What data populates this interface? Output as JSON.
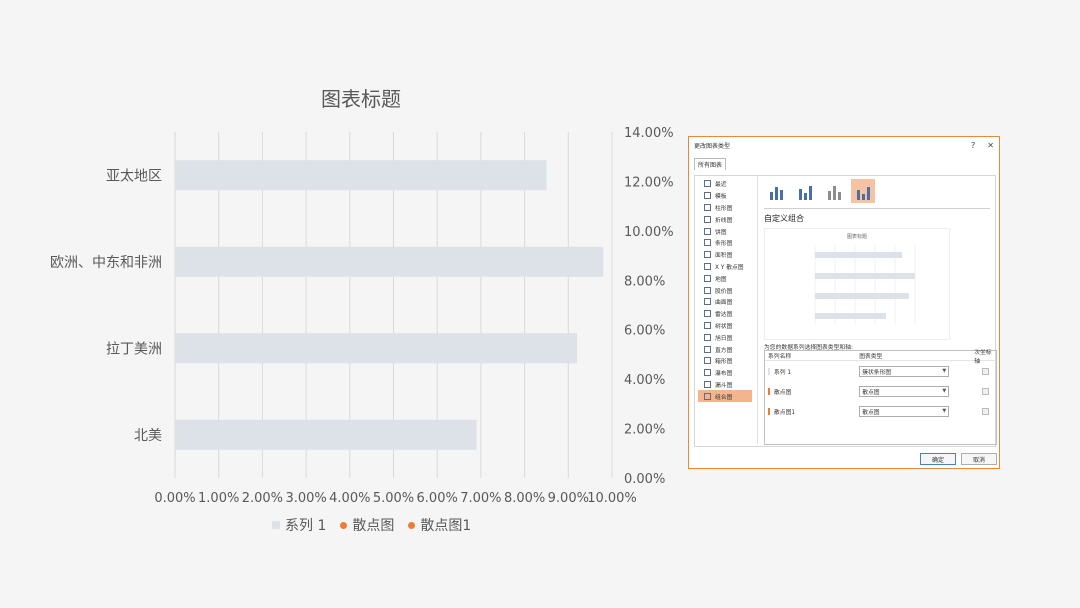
{
  "chart_data": {
    "type": "bar",
    "title": "图表标题",
    "categories": [
      "亚太地区",
      "欧洲、中东和非洲",
      "拉丁美洲",
      "北美"
    ],
    "series": [
      {
        "name": "系列 1",
        "values": [
          0.085,
          0.098,
          0.092,
          0.069
        ]
      }
    ],
    "x_ticks": [
      "0.00%",
      "1.00%",
      "2.00%",
      "3.00%",
      "4.00%",
      "5.00%",
      "6.00%",
      "7.00%",
      "8.00%",
      "9.00%",
      "10.00%"
    ],
    "xlim": [
      0,
      0.1
    ],
    "secondary_y_ticks": [
      "14.00%",
      "12.00%",
      "10.00%",
      "8.00%",
      "6.00%",
      "4.00%",
      "2.00%",
      "0.00%"
    ],
    "secondary_ylim": [
      0,
      0.14
    ],
    "grid": true,
    "legend_position": "bottom",
    "legend": [
      {
        "name": "系列 1",
        "color": "#dce2e8",
        "shape": "square"
      },
      {
        "name": "散点图",
        "color": "#ed7d31",
        "shape": "dot"
      },
      {
        "name": "散点图1",
        "color": "#ed7d31",
        "shape": "dot"
      }
    ],
    "bar_color": "#dce2e8"
  },
  "dialog": {
    "title": "更改图表类型",
    "help": "?",
    "close": "✕",
    "tab": "所有图表",
    "categories": [
      "最近",
      "模板",
      "柱形图",
      "折线图",
      "饼图",
      "条形图",
      "面积图",
      "X Y 散点图",
      "地图",
      "股价图",
      "曲面图",
      "雷达图",
      "树状图",
      "旭日图",
      "直方图",
      "箱形图",
      "瀑布图",
      "漏斗图",
      "组合图"
    ],
    "selected_category": "组合图",
    "combo_title": "自定义组合",
    "preview_title": "图表标题",
    "prompt": "为您的数据系列选择图表类型和轴:",
    "columns": [
      "系列名称",
      "图表类型",
      "次坐标轴"
    ],
    "rows": [
      {
        "name": "系列 1",
        "type": "簇状条形图",
        "color": "#dce2e8"
      },
      {
        "name": "散点图",
        "type": "散点图",
        "color": "#ed7d31"
      },
      {
        "name": "散点图1",
        "type": "散点图",
        "color": "#ed7d31"
      }
    ],
    "ok": "确定",
    "cancel": "取消"
  }
}
